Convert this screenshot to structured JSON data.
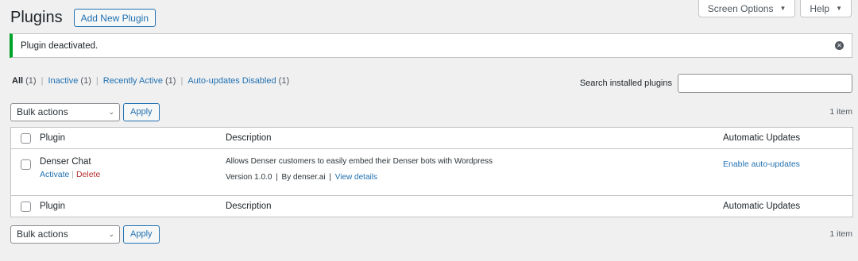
{
  "screen_meta": {
    "screen_options": "Screen Options",
    "help": "Help"
  },
  "header": {
    "title": "Plugins",
    "add_new": "Add New Plugin"
  },
  "notice": {
    "message": "Plugin deactivated."
  },
  "filters": [
    {
      "label": "All",
      "count": "(1)"
    },
    {
      "label": "Inactive",
      "count": "(1)"
    },
    {
      "label": "Recently Active",
      "count": "(1)"
    },
    {
      "label": "Auto-updates Disabled",
      "count": "(1)"
    }
  ],
  "separator": "|",
  "search": {
    "label": "Search installed plugins",
    "value": ""
  },
  "tablenav": {
    "bulk_actions": "Bulk actions",
    "apply": "Apply",
    "count": "1 item"
  },
  "table": {
    "columns": {
      "plugin": "Plugin",
      "description": "Description",
      "auto_updates": "Automatic Updates"
    },
    "rows": [
      {
        "name": "Denser Chat",
        "activate": "Activate",
        "delete": "Delete",
        "description": "Allows Denser customers to easily embed their Denser bots with Wordpress",
        "version": "Version 1.0.0",
        "by": "By denser.ai",
        "view_details": "View details",
        "auto_update": "Enable auto-updates"
      }
    ]
  }
}
